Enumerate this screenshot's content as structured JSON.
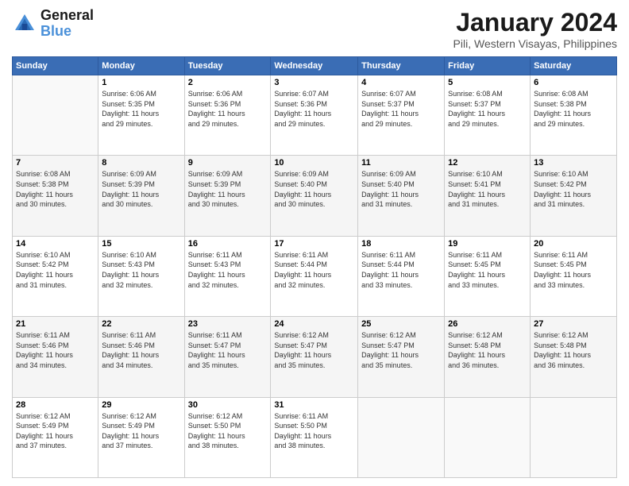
{
  "logo": {
    "line1": "General",
    "line2": "Blue"
  },
  "title": "January 2024",
  "subtitle": "Pili, Western Visayas, Philippines",
  "headers": [
    "Sunday",
    "Monday",
    "Tuesday",
    "Wednesday",
    "Thursday",
    "Friday",
    "Saturday"
  ],
  "weeks": [
    [
      {
        "day": "",
        "info": ""
      },
      {
        "day": "1",
        "info": "Sunrise: 6:06 AM\nSunset: 5:35 PM\nDaylight: 11 hours\nand 29 minutes."
      },
      {
        "day": "2",
        "info": "Sunrise: 6:06 AM\nSunset: 5:36 PM\nDaylight: 11 hours\nand 29 minutes."
      },
      {
        "day": "3",
        "info": "Sunrise: 6:07 AM\nSunset: 5:36 PM\nDaylight: 11 hours\nand 29 minutes."
      },
      {
        "day": "4",
        "info": "Sunrise: 6:07 AM\nSunset: 5:37 PM\nDaylight: 11 hours\nand 29 minutes."
      },
      {
        "day": "5",
        "info": "Sunrise: 6:08 AM\nSunset: 5:37 PM\nDaylight: 11 hours\nand 29 minutes."
      },
      {
        "day": "6",
        "info": "Sunrise: 6:08 AM\nSunset: 5:38 PM\nDaylight: 11 hours\nand 29 minutes."
      }
    ],
    [
      {
        "day": "7",
        "info": "Sunrise: 6:08 AM\nSunset: 5:38 PM\nDaylight: 11 hours\nand 30 minutes."
      },
      {
        "day": "8",
        "info": "Sunrise: 6:09 AM\nSunset: 5:39 PM\nDaylight: 11 hours\nand 30 minutes."
      },
      {
        "day": "9",
        "info": "Sunrise: 6:09 AM\nSunset: 5:39 PM\nDaylight: 11 hours\nand 30 minutes."
      },
      {
        "day": "10",
        "info": "Sunrise: 6:09 AM\nSunset: 5:40 PM\nDaylight: 11 hours\nand 30 minutes."
      },
      {
        "day": "11",
        "info": "Sunrise: 6:09 AM\nSunset: 5:40 PM\nDaylight: 11 hours\nand 31 minutes."
      },
      {
        "day": "12",
        "info": "Sunrise: 6:10 AM\nSunset: 5:41 PM\nDaylight: 11 hours\nand 31 minutes."
      },
      {
        "day": "13",
        "info": "Sunrise: 6:10 AM\nSunset: 5:42 PM\nDaylight: 11 hours\nand 31 minutes."
      }
    ],
    [
      {
        "day": "14",
        "info": "Sunrise: 6:10 AM\nSunset: 5:42 PM\nDaylight: 11 hours\nand 31 minutes."
      },
      {
        "day": "15",
        "info": "Sunrise: 6:10 AM\nSunset: 5:43 PM\nDaylight: 11 hours\nand 32 minutes."
      },
      {
        "day": "16",
        "info": "Sunrise: 6:11 AM\nSunset: 5:43 PM\nDaylight: 11 hours\nand 32 minutes."
      },
      {
        "day": "17",
        "info": "Sunrise: 6:11 AM\nSunset: 5:44 PM\nDaylight: 11 hours\nand 32 minutes."
      },
      {
        "day": "18",
        "info": "Sunrise: 6:11 AM\nSunset: 5:44 PM\nDaylight: 11 hours\nand 33 minutes."
      },
      {
        "day": "19",
        "info": "Sunrise: 6:11 AM\nSunset: 5:45 PM\nDaylight: 11 hours\nand 33 minutes."
      },
      {
        "day": "20",
        "info": "Sunrise: 6:11 AM\nSunset: 5:45 PM\nDaylight: 11 hours\nand 33 minutes."
      }
    ],
    [
      {
        "day": "21",
        "info": "Sunrise: 6:11 AM\nSunset: 5:46 PM\nDaylight: 11 hours\nand 34 minutes."
      },
      {
        "day": "22",
        "info": "Sunrise: 6:11 AM\nSunset: 5:46 PM\nDaylight: 11 hours\nand 34 minutes."
      },
      {
        "day": "23",
        "info": "Sunrise: 6:11 AM\nSunset: 5:47 PM\nDaylight: 11 hours\nand 35 minutes."
      },
      {
        "day": "24",
        "info": "Sunrise: 6:12 AM\nSunset: 5:47 PM\nDaylight: 11 hours\nand 35 minutes."
      },
      {
        "day": "25",
        "info": "Sunrise: 6:12 AM\nSunset: 5:47 PM\nDaylight: 11 hours\nand 35 minutes."
      },
      {
        "day": "26",
        "info": "Sunrise: 6:12 AM\nSunset: 5:48 PM\nDaylight: 11 hours\nand 36 minutes."
      },
      {
        "day": "27",
        "info": "Sunrise: 6:12 AM\nSunset: 5:48 PM\nDaylight: 11 hours\nand 36 minutes."
      }
    ],
    [
      {
        "day": "28",
        "info": "Sunrise: 6:12 AM\nSunset: 5:49 PM\nDaylight: 11 hours\nand 37 minutes."
      },
      {
        "day": "29",
        "info": "Sunrise: 6:12 AM\nSunset: 5:49 PM\nDaylight: 11 hours\nand 37 minutes."
      },
      {
        "day": "30",
        "info": "Sunrise: 6:12 AM\nSunset: 5:50 PM\nDaylight: 11 hours\nand 38 minutes."
      },
      {
        "day": "31",
        "info": "Sunrise: 6:11 AM\nSunset: 5:50 PM\nDaylight: 11 hours\nand 38 minutes."
      },
      {
        "day": "",
        "info": ""
      },
      {
        "day": "",
        "info": ""
      },
      {
        "day": "",
        "info": ""
      }
    ]
  ]
}
